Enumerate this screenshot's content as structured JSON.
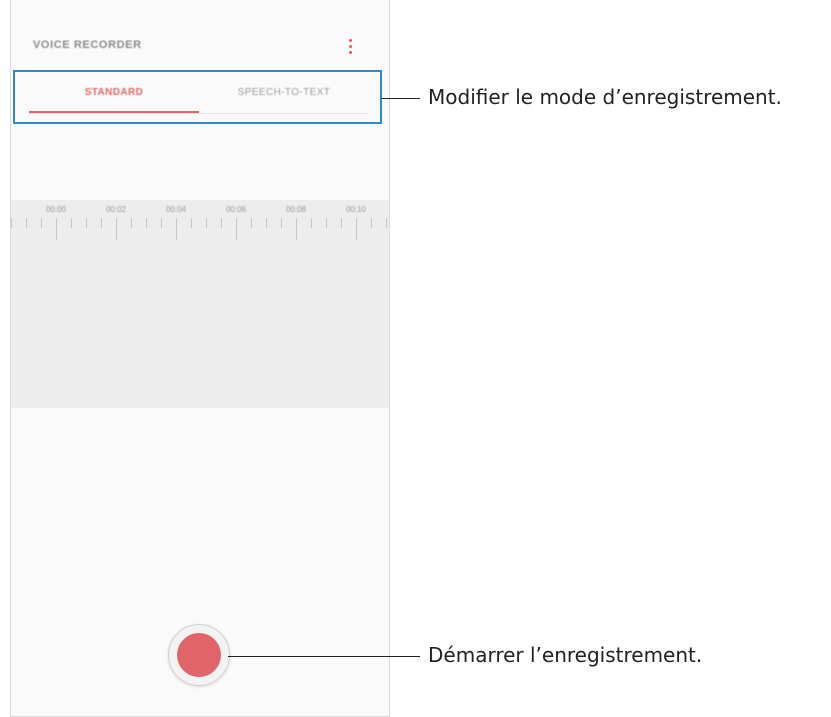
{
  "app": {
    "title": "VOICE RECORDER",
    "menu_icon": "more-vert-icon",
    "accent_color": "#e06767"
  },
  "tabs": [
    {
      "label": "STANDARD",
      "active": true
    },
    {
      "label": "SPEECH-TO-TEXT",
      "active": false
    }
  ],
  "timeline": {
    "labels": [
      "00:00",
      "00:02",
      "00:04",
      "00:06",
      "00:08",
      "00:10"
    ]
  },
  "record_button": {
    "icon": "record-icon",
    "color": "#e0646a"
  },
  "callouts": {
    "mode": "Modifier le mode d’enregistrement.",
    "record": "Démarrer l’enregistrement."
  },
  "highlight_color": "#2d8bc9"
}
